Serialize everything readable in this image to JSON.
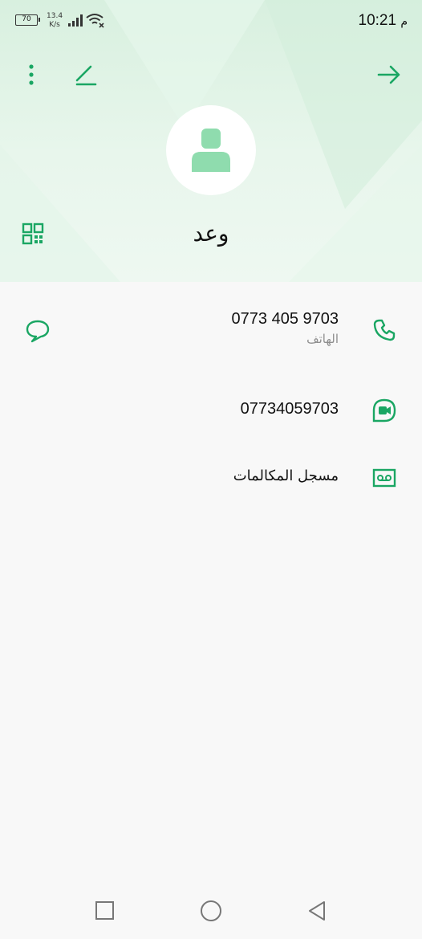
{
  "status_bar": {
    "battery": "70",
    "net_speed_value": "13.4",
    "net_speed_unit": "K/s",
    "time": "10:21",
    "am_pm": "م"
  },
  "contact": {
    "name": "وعد"
  },
  "rows": {
    "phone_number": "0773 405 9703",
    "phone_label": "الهاتف",
    "video_number": "07734059703",
    "call_log_label": "مسجل المكالمات"
  },
  "colors": {
    "accent": "#1aa663",
    "header_bg": "#dff3e5",
    "avatar_figure": "#8fdcae"
  },
  "icons": {
    "back": "arrow-right-icon",
    "edit": "pencil-icon",
    "more": "more-vertical-icon",
    "qr": "qr-code-icon",
    "call": "phone-icon",
    "message": "message-bubble-icon",
    "video": "video-call-icon",
    "voicemail": "voicemail-icon"
  }
}
